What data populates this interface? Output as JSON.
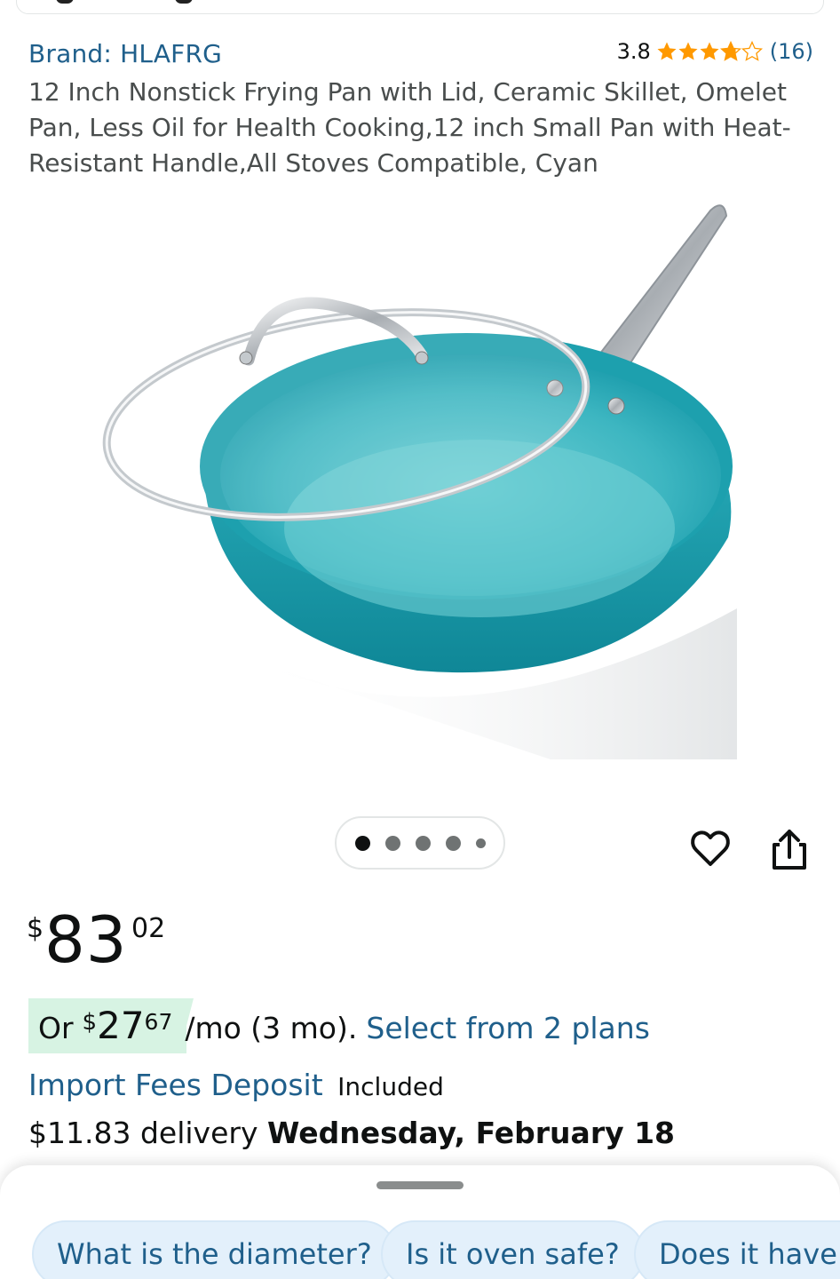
{
  "brand": "Brand: HLAFRG",
  "rating": {
    "score": "3.8",
    "stars": 3.8,
    "count": "(16)",
    "star_color": "#ff9900"
  },
  "title": "12 Inch Nonstick Frying Pan with Lid, Ceramic Skillet, Omelet Pan, Less Oil for Health Cooking,12 inch Small Pan with Heat-Resistant Handle,All Stoves Compatible, Cyan",
  "image": {
    "pan_color": "#23a6b4",
    "carousel_pages": 5,
    "current_page": 1
  },
  "price": {
    "symbol": "$",
    "whole": "83",
    "fraction": "02"
  },
  "installment": {
    "or": "Or",
    "symbol": "$",
    "whole": "27",
    "fraction": "67",
    "terms": "/mo (3 mo).",
    "plans_link": "Select from 2 plans"
  },
  "import": {
    "link": "Import Fees Deposit",
    "status": "Included"
  },
  "delivery": {
    "cost": "$11.83 delivery",
    "date": "Wednesday, February 18"
  },
  "questions": [
    "What is the diameter?",
    "Is it oven safe?",
    "Does it have a"
  ],
  "icons": {
    "wishlist": "heart-icon",
    "share": "share-icon"
  },
  "colors": {
    "link": "#1f5f8b",
    "badge_bg": "#d7f3e3",
    "chip_bg": "#e3f0fb"
  }
}
